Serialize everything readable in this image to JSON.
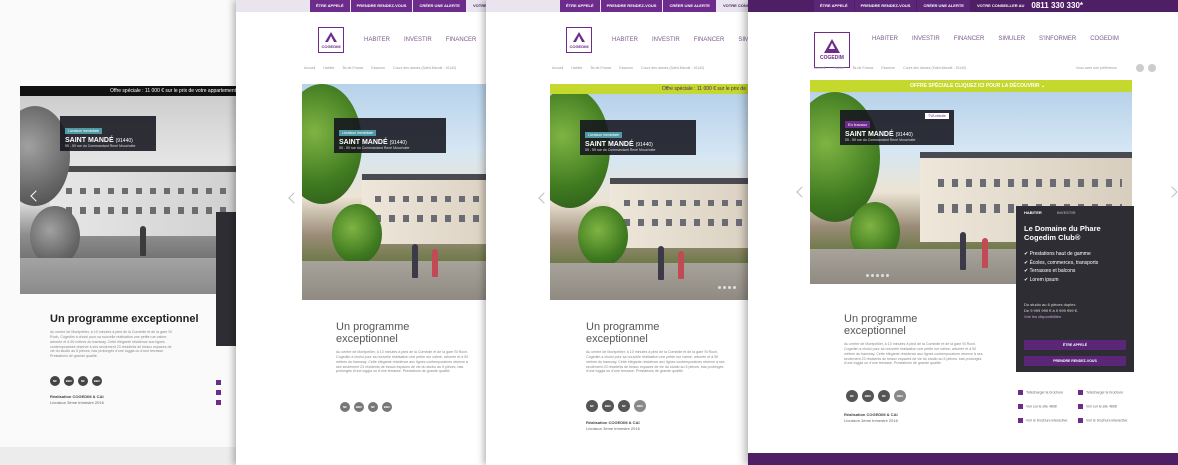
{
  "topbar": {
    "etre_appele": "ÊTRE APPELÉ",
    "rendez_vous": "PRENDRE RENDEZ-VOUS",
    "creer_alerte": "CRÉER UNE ALERTE",
    "conseiller": "VOTRE CONSEILLER AU",
    "phone": "0811 330 330*"
  },
  "logo": "COGEDIM",
  "nav": [
    "HABITER",
    "INVESTIR",
    "FINANCER",
    "SIMULER",
    "S'INFORMER",
    "COGEDIM"
  ],
  "breadcrumb": [
    "Accueil",
    "Habiter",
    "Île-de-France",
    "Essonne",
    "Cours des dames (Saint-Mandé - 91140)"
  ],
  "offer": {
    "v1": "Offre spéciale : 11 000 € sur le prix de votre appartement",
    "v2": "Offre spéciale : 11 000 € sur le prix de",
    "v4": "OFFRE SPÉCIALE CLIQUEZ ICI POUR LA DÉCOUVRIR"
  },
  "property": {
    "stage": "Livraison immédiate",
    "stage_v4": "En travaux",
    "vat": "TVA réduite",
    "name": "SAINT MANDÉ",
    "postcode": "(91440)",
    "address": "55 - 59 rue du Commandant René Mouchotte"
  },
  "program": {
    "title": "Un programme exceptionnel",
    "body": "Au centre de Montpellier, à 10 minutes à pied de la Comédie et de la gare St Roch, Cogedim a choisi pour sa nouvelle réalisation une petite rue calme, arborée et à 50 mètres du tramway. Cette élégante résidence aux lignes contemporaines réserve à ses seulement 23 résidents de beaux espaces de vie du studio au 5 pièces, bas prolongés d'une loggia ou d'une terrasse. Prestations de grande qualité.",
    "badges": [
      "NF",
      "BBC",
      "NF",
      "BBC"
    ],
    "realisation": "Réalisation COGEDIM & CAI",
    "livraison": "Livraison 3ème trimestre 2016"
  },
  "panel": {
    "tabs": [
      "HABITER",
      "INVESTIR"
    ],
    "title": "Le Domaine du Phare Cogedim Club®",
    "features": [
      "Prestations haut de gamme",
      "Écoles, commerces, transports",
      "Terrasses et balcons",
      "Lorem ipsum"
    ],
    "offer_line": "Du studio au 6 pièces duplex.",
    "price_line": "De 9 999 999 € à 9 999 999 €.",
    "dispo": "Voir les disponibilités",
    "btn_call": "ÊTRE APPELÉ",
    "btn_rdv": "PRENDRE RENDEZ-VOUS"
  },
  "downloads": [
    "Télécharger la brochure",
    "Télécharger la brochure",
    "Voir sur le site 4808",
    "Voir sur le site 4808",
    "Voir le brochure interactive",
    "Voir le brochure interactive"
  ],
  "search_hint": "Vous avez une préférence",
  "colors": {
    "purple": "#6d2b8c",
    "lime": "#c4d82e",
    "dark_purple": "#4f1f66"
  }
}
